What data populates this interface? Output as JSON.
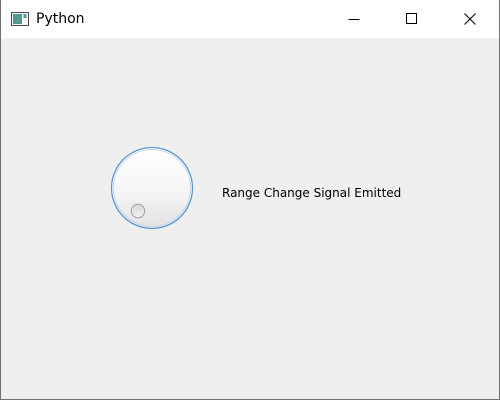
{
  "window": {
    "title": "Python"
  },
  "controls": {
    "minimize_icon": "minimize-icon",
    "maximize_icon": "maximize-icon",
    "close_icon": "close-icon"
  },
  "dial": {
    "label": "Range Change Signal Emitted"
  },
  "colors": {
    "titlebar": "#ffffff",
    "client_bg": "#efefef",
    "dial_border": "#6a9ed1"
  }
}
